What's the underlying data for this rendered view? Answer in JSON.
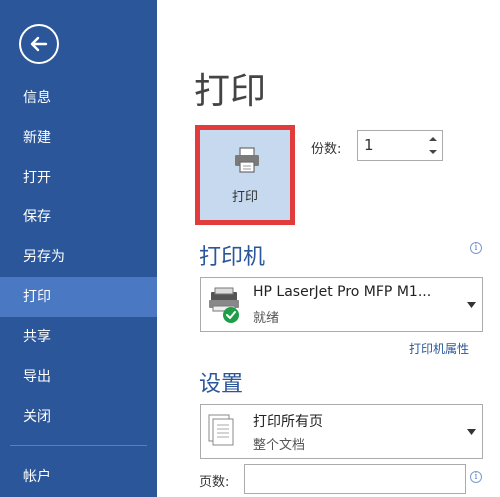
{
  "sidebar": {
    "items": [
      {
        "label": "信息"
      },
      {
        "label": "新建"
      },
      {
        "label": "打开"
      },
      {
        "label": "保存"
      },
      {
        "label": "另存为"
      },
      {
        "label": "打印"
      },
      {
        "label": "共享"
      },
      {
        "label": "导出"
      },
      {
        "label": "关闭"
      },
      {
        "label": "帐户"
      }
    ],
    "active": "打印"
  },
  "main": {
    "title": "打印",
    "print_button_label": "打印",
    "copies_label": "份数:",
    "copies_value": "1",
    "printer_section_title": "打印机",
    "printer_name": "HP LaserJet Pro MFP M1...",
    "printer_status": "就绪",
    "printer_properties_link": "打印机属性",
    "settings_section_title": "设置",
    "print_range_main": "打印所有页",
    "print_range_sub": "整个文档",
    "pages_label": "页数:",
    "pages_value": "",
    "info_glyph": "i"
  },
  "colors": {
    "sidebar_bg": "#2b579a",
    "sidebar_active": "#4a78c2",
    "accent": "#2b579a",
    "highlight_border": "#e23b3b",
    "print_button_bg": "#c6d9ef"
  }
}
